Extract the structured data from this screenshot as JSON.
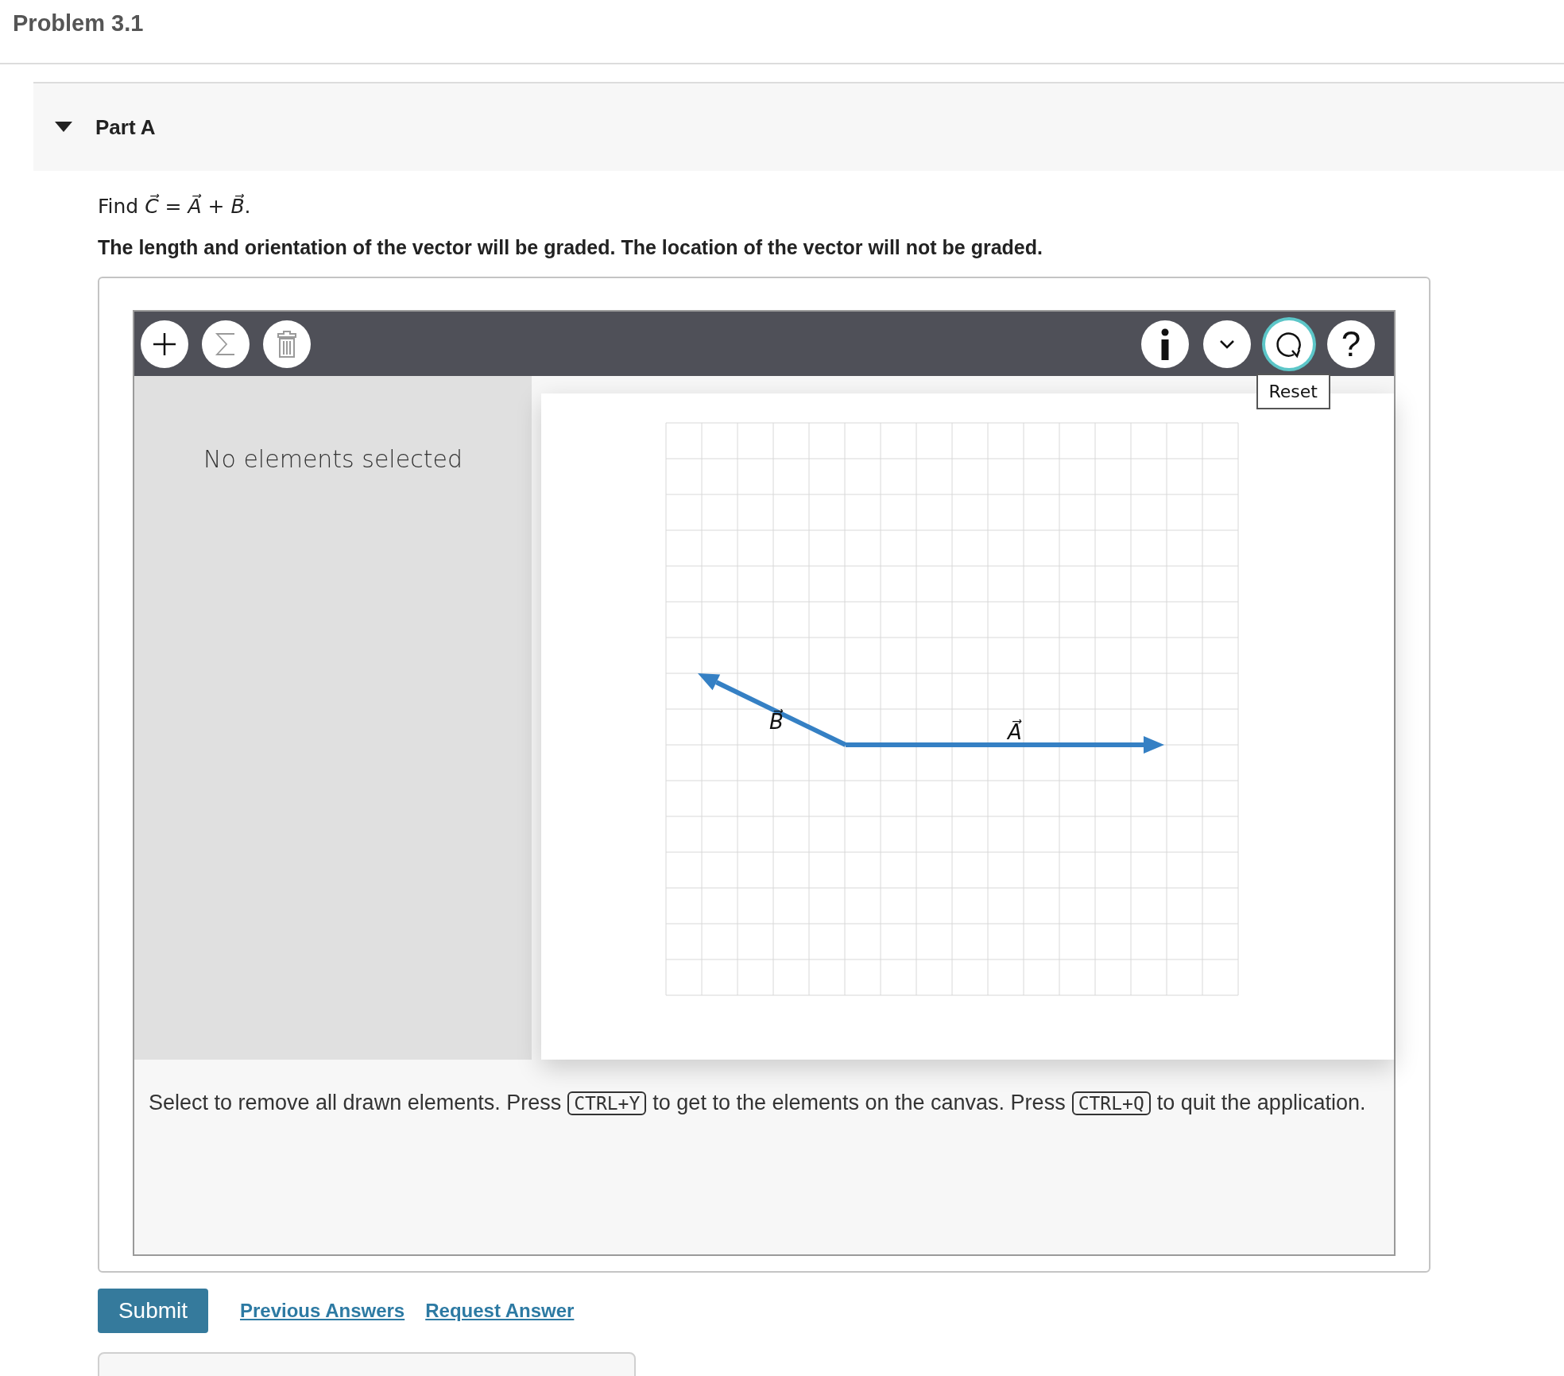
{
  "page_title": "Problem 3.1",
  "part": {
    "title": "Part A",
    "expanded": true
  },
  "question": "Find *C⃗* = *A⃗* + *B⃗*.",
  "instruction": "The length and orientation of the vector will be graded. The location of the vector will not be graded.",
  "toolbar_left": [
    {
      "kind": "add",
      "disabled": false
    },
    {
      "kind": "sum",
      "disabled": true
    },
    {
      "kind": "delete",
      "disabled": true
    }
  ],
  "toolbar_right": [
    {
      "kind": "info",
      "focused": false
    },
    {
      "kind": "menu",
      "focused": false
    },
    {
      "kind": "reset",
      "focused": true
    },
    {
      "kind": "help",
      "label": "?",
      "focused": false
    }
  ],
  "tooltip": "Reset",
  "side_panel": "No elements selected",
  "vectors": [
    {
      "label": "B⃗"
    },
    {
      "label": "A⃗"
    }
  ],
  "help_text": [
    {
      "kind": "text",
      "text": "Select to remove all drawn elements. Press"
    },
    {
      "kind": "key",
      "text": "CTRL+Y"
    },
    {
      "kind": "text",
      "text": "to get to the elements on the canvas. Press"
    },
    {
      "kind": "key",
      "text": "CTRL+Q"
    },
    {
      "kind": "text",
      "text": "to quit the"
    },
    {
      "kind": "text",
      "text": "application."
    }
  ],
  "buttons": [
    {
      "kind": "primary",
      "label": "Submit"
    },
    {
      "kind": "link",
      "label": "Previous Answers"
    },
    {
      "kind": "link",
      "label": "Request Answer"
    }
  ]
}
